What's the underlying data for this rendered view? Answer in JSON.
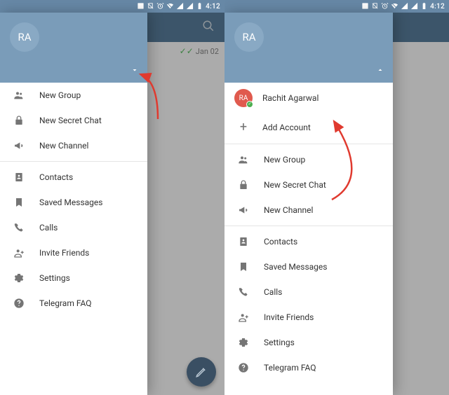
{
  "status": {
    "time": "4:12"
  },
  "avatar_initials": "RA",
  "chat_preview_date": "Jan 02",
  "menu": {
    "new_group": "New Group",
    "new_secret_chat": "New Secret Chat",
    "new_channel": "New Channel",
    "contacts": "Contacts",
    "saved_messages": "Saved Messages",
    "calls": "Calls",
    "invite_friends": "Invite Friends",
    "settings": "Settings",
    "faq": "Telegram FAQ"
  },
  "accounts": {
    "current_name": "Rachit Agarwal",
    "current_initials": "RA",
    "add_account": "Add Account"
  }
}
